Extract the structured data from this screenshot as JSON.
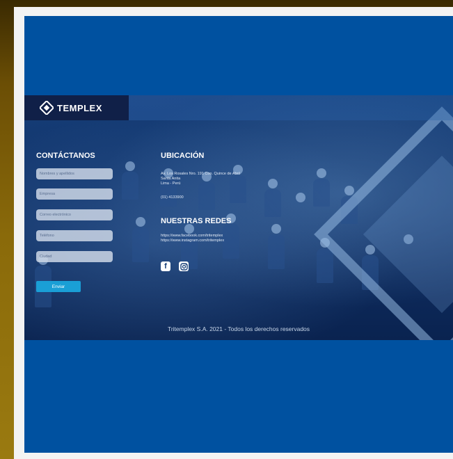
{
  "brand": {
    "logo_text": "TEMPLEX"
  },
  "contact": {
    "title": "CONTÁCTANOS",
    "fields": [
      {
        "placeholder": "Nombres y apellidos"
      },
      {
        "placeholder": "Empresa"
      },
      {
        "placeholder": "Correo electrónico"
      },
      {
        "placeholder": "Teléfono"
      },
      {
        "placeholder": "Ciudad"
      }
    ],
    "submit_label": "Enviar"
  },
  "location": {
    "title": "UBICACIÓN",
    "address_line1": "Av. Los Rosales Nro. 191 Coo. Quince de Abril",
    "address_line2": "Santa Anita",
    "address_line3": "Lima - Perú",
    "phone": "(01) 4133900"
  },
  "social": {
    "title": "NUESTRAS REDES",
    "facebook_url": "https://www.facebook.com/tritemplex",
    "instagram_url": "https://www.instagram.com/tritemplex",
    "icons": [
      "facebook-icon",
      "instagram-icon"
    ]
  },
  "footer": {
    "copyright": "Tritemplex S.A. 2021 - Todos los derechos reservados"
  }
}
